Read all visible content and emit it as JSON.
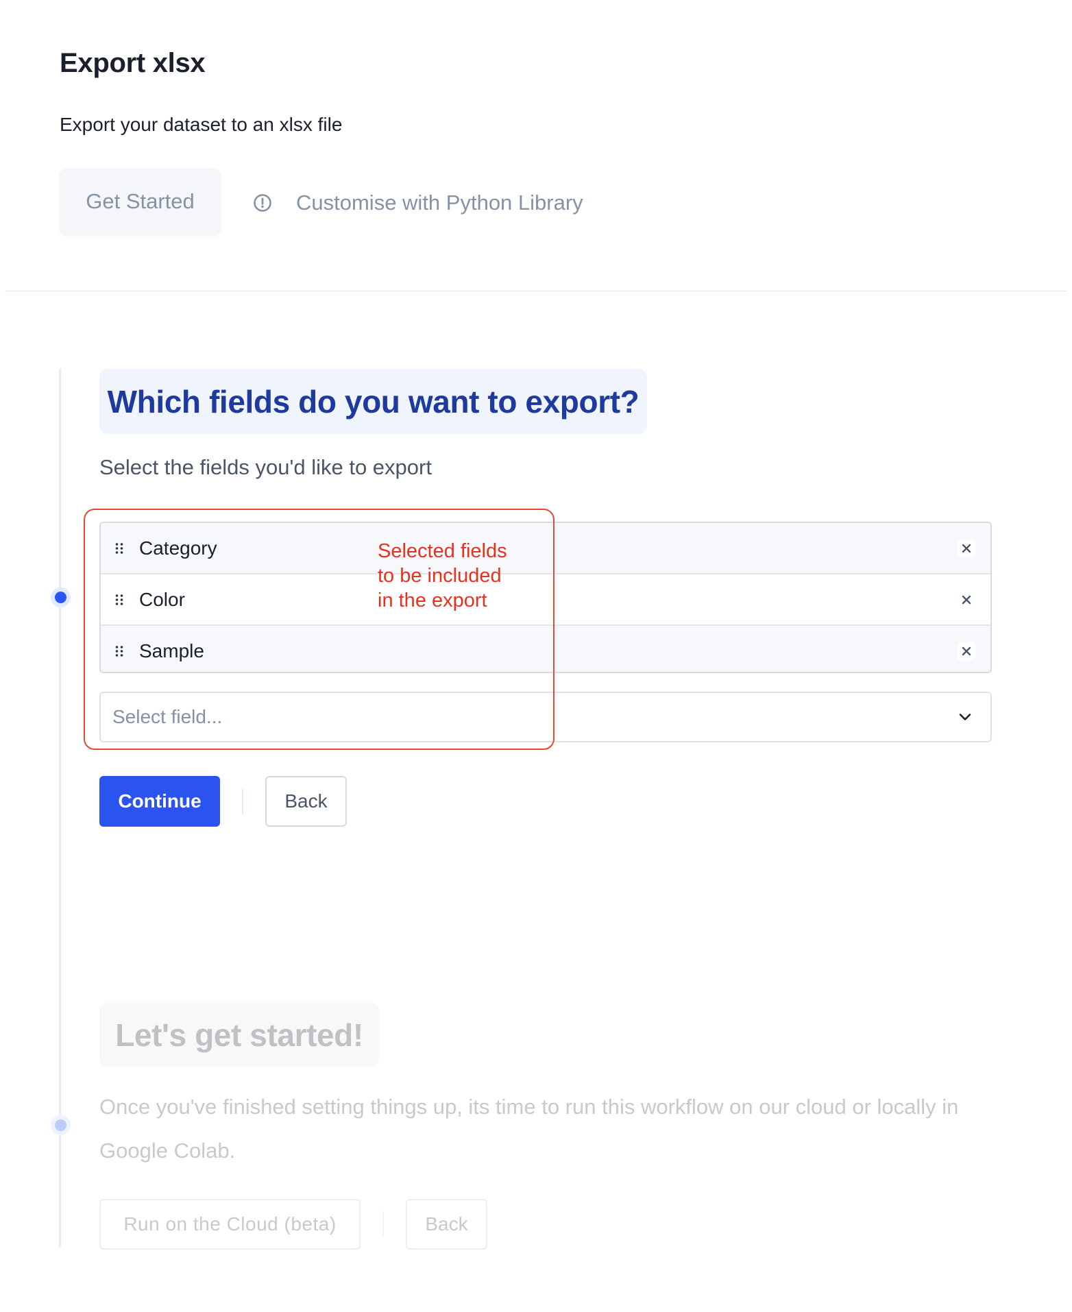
{
  "header": {
    "title": "Export xlsx",
    "subtitle": "Export your dataset to an xlsx file",
    "tabs": [
      {
        "label": "Get Started",
        "icon": null
      },
      {
        "label": "Customise with Python Library",
        "icon": "info-circle-icon"
      }
    ]
  },
  "step1": {
    "heading": "Which fields do you want to export?",
    "description": "Select the fields you'd like to export",
    "fields": [
      {
        "label": "Category",
        "drag_icon": "drag-handle-icon",
        "remove_icon": "close-icon"
      },
      {
        "label": "Color",
        "drag_icon": "drag-handle-icon",
        "remove_icon": "close-icon"
      },
      {
        "label": "Sample",
        "drag_icon": "drag-handle-icon",
        "remove_icon": "close-icon"
      }
    ],
    "select": {
      "placeholder": "Select field...",
      "icon": "chevron-down-icon"
    },
    "annotation": {
      "lines": [
        "Selected fields",
        "to be included",
        "in the export"
      ],
      "color": "#e8311d"
    },
    "buttons": {
      "continue": "Continue",
      "back": "Back"
    },
    "state": "active"
  },
  "step2": {
    "heading": "Let's get started!",
    "description": "Once you've finished setting things up, its time to run this workflow on our cloud or locally in Google Colab.",
    "buttons": {
      "run_cloud": "Run on the Cloud (beta)",
      "back": "Back"
    },
    "state": "disabled"
  },
  "colors": {
    "primary": "#2b53f0",
    "heading_active": "#1e3a9f",
    "annotation": "#e34a2e",
    "muted_text": "#8492a6"
  }
}
